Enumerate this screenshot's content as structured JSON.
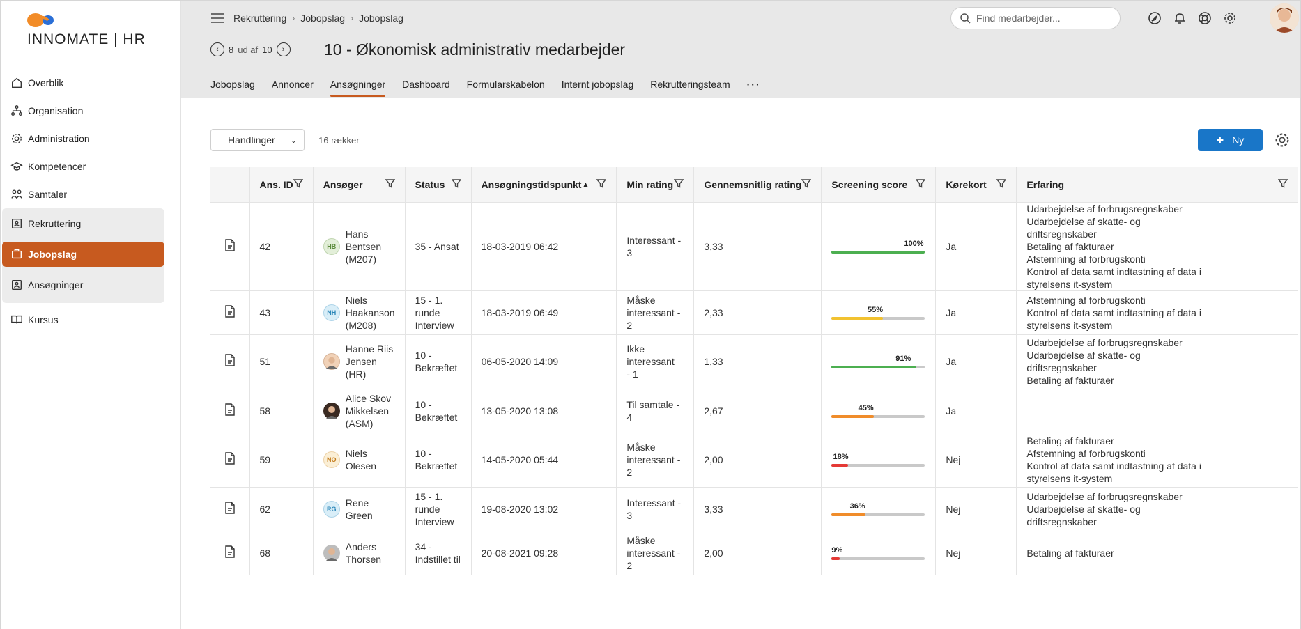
{
  "logo": {
    "text": "INNOMATE | HR"
  },
  "sidebar": {
    "items": [
      {
        "label": "Overblik",
        "icon": "home-icon"
      },
      {
        "label": "Organisation",
        "icon": "org-chart-icon"
      },
      {
        "label": "Administration",
        "icon": "gear-icon"
      },
      {
        "label": "Kompetencer",
        "icon": "graduation-cap-icon"
      },
      {
        "label": "Samtaler",
        "icon": "people-icon"
      }
    ],
    "group": {
      "label": "Rekruttering",
      "active_label": "Jobopslag",
      "sub_label": "Ansøgninger"
    },
    "kursus": "Kursus"
  },
  "breadcrumb": [
    "Rekruttering",
    "Jobopslag",
    "Jobopslag"
  ],
  "search": {
    "placeholder": "Find medarbejder..."
  },
  "pager": {
    "current": "8",
    "of_label": "ud af",
    "total": "10"
  },
  "page_title": "10 - Økonomisk administrativ medarbejder",
  "tabs": [
    "Jobopslag",
    "Annoncer",
    "Ansøgninger",
    "Dashboard",
    "Formularskabelon",
    "Internt jobopslag",
    "Rekrutteringsteam",
    "···"
  ],
  "toolbar": {
    "actions_label": "Handlinger",
    "row_count": "16 rækker",
    "new_label": "Ny"
  },
  "colors": {
    "accent": "#c75a1f",
    "primary": "#1976c8",
    "green": "#4caf50",
    "yellow": "#f2c230",
    "orange": "#f08c2a",
    "red": "#e53935"
  },
  "table": {
    "columns": [
      "Ans. ID",
      "Ansøger",
      "Status",
      "Ansøgningstidspunkt",
      "Min rating",
      "Gennemsnitlig rating",
      "Screening score",
      "Kørekort",
      "Erfaring"
    ],
    "rows": [
      {
        "id": "42",
        "name": [
          "Hans",
          "Bentsen",
          "(M207)"
        ],
        "initials": "HB",
        "avatar_bg": "#e3efd9",
        "avatar_fg": "#5a8a3a",
        "status": [
          "35 - Ansat"
        ],
        "time": "18-03-2019 06:42",
        "rating": [
          "Interessant - 3"
        ],
        "avg": "3,33",
        "score": 100,
        "score_label": "100%",
        "score_color": "#4caf50",
        "license": "Ja",
        "exp": [
          "Udarbejdelse af forbrugsregnskaber",
          "Udarbejdelse af skatte- og",
          "driftsregnskaber",
          "Betaling af fakturaer",
          "Afstemning af forbrugskonti",
          "Kontrol af data samt indtastning af data i",
          "styrelsens it-system"
        ]
      },
      {
        "id": "43",
        "name": [
          "Niels",
          "Haakanson",
          "(M208)"
        ],
        "initials": "NH",
        "avatar_bg": "#d9eef8",
        "avatar_fg": "#2b86b8",
        "status": [
          "15 - 1. runde",
          "Interview"
        ],
        "time": "18-03-2019 06:49",
        "rating": [
          "Måske",
          "interessant - 2"
        ],
        "avg": "2,33",
        "score": 55,
        "score_label": "55%",
        "score_color": "#f2c230",
        "license": "Ja",
        "exp": [
          "Afstemning af forbrugskonti",
          "Kontrol af data samt indtastning af data i",
          "styrelsens it-system"
        ]
      },
      {
        "id": "51",
        "name": [
          "Hanne Riis",
          "Jensen (HR)"
        ],
        "initials": "",
        "avatar_bg": "#f1d2b8",
        "avatar_fg": "#8a5a3a",
        "status": [
          "10 -",
          "Bekræftet"
        ],
        "time": "06-05-2020 14:09",
        "rating": [
          "Ikke interessant",
          "- 1"
        ],
        "avg": "1,33",
        "score": 91,
        "score_label": "91%",
        "score_color": "#4caf50",
        "license": "Ja",
        "exp": [
          "Udarbejdelse af forbrugsregnskaber",
          "Udarbejdelse af skatte- og",
          "driftsregnskaber",
          "Betaling af fakturaer"
        ]
      },
      {
        "id": "58",
        "name": [
          "Alice Skov",
          "Mikkelsen",
          "(ASM)"
        ],
        "initials": "",
        "avatar_bg": "#3a2a22",
        "avatar_fg": "#fff",
        "status": [
          "10 -",
          "Bekræftet"
        ],
        "time": "13-05-2020 13:08",
        "rating": [
          "Til samtale - 4"
        ],
        "avg": "2,67",
        "score": 45,
        "score_label": "45%",
        "score_color": "#f08c2a",
        "license": "Ja",
        "exp": []
      },
      {
        "id": "59",
        "name": [
          "Niels Olesen"
        ],
        "initials": "NO",
        "avatar_bg": "#fbefd6",
        "avatar_fg": "#c27a1a",
        "status": [
          "10 -",
          "Bekræftet"
        ],
        "time": "14-05-2020 05:44",
        "rating": [
          "Måske",
          "interessant - 2"
        ],
        "avg": "2,00",
        "score": 18,
        "score_label": "18%",
        "score_color": "#e53935",
        "license": "Nej",
        "exp": [
          "Betaling af fakturaer",
          "Afstemning af forbrugskonti",
          "Kontrol af data samt indtastning af data i",
          "styrelsens it-system"
        ]
      },
      {
        "id": "62",
        "name": [
          "Rene Green"
        ],
        "initials": "RG",
        "avatar_bg": "#d9eef8",
        "avatar_fg": "#2b86b8",
        "status": [
          "15 - 1. runde",
          "Interview"
        ],
        "time": "19-08-2020 13:02",
        "rating": [
          "Interessant - 3"
        ],
        "avg": "3,33",
        "score": 36,
        "score_label": "36%",
        "score_color": "#f08c2a",
        "license": "Nej",
        "exp": [
          "Udarbejdelse af forbrugsregnskaber",
          "Udarbejdelse af skatte- og",
          "driftsregnskaber"
        ]
      },
      {
        "id": "68",
        "name": [
          "Anders",
          "Thorsen"
        ],
        "initials": "",
        "avatar_bg": "#bdbdbd",
        "avatar_fg": "#333",
        "status": [
          "34 -",
          "Indstillet til"
        ],
        "time": "20-08-2021 09:28",
        "rating": [
          "Måske",
          "interessant - 2"
        ],
        "avg": "2,00",
        "score": 9,
        "score_label": "9%",
        "score_color": "#e53935",
        "license": "Nej",
        "exp": [
          "Betaling af fakturaer"
        ]
      }
    ]
  }
}
